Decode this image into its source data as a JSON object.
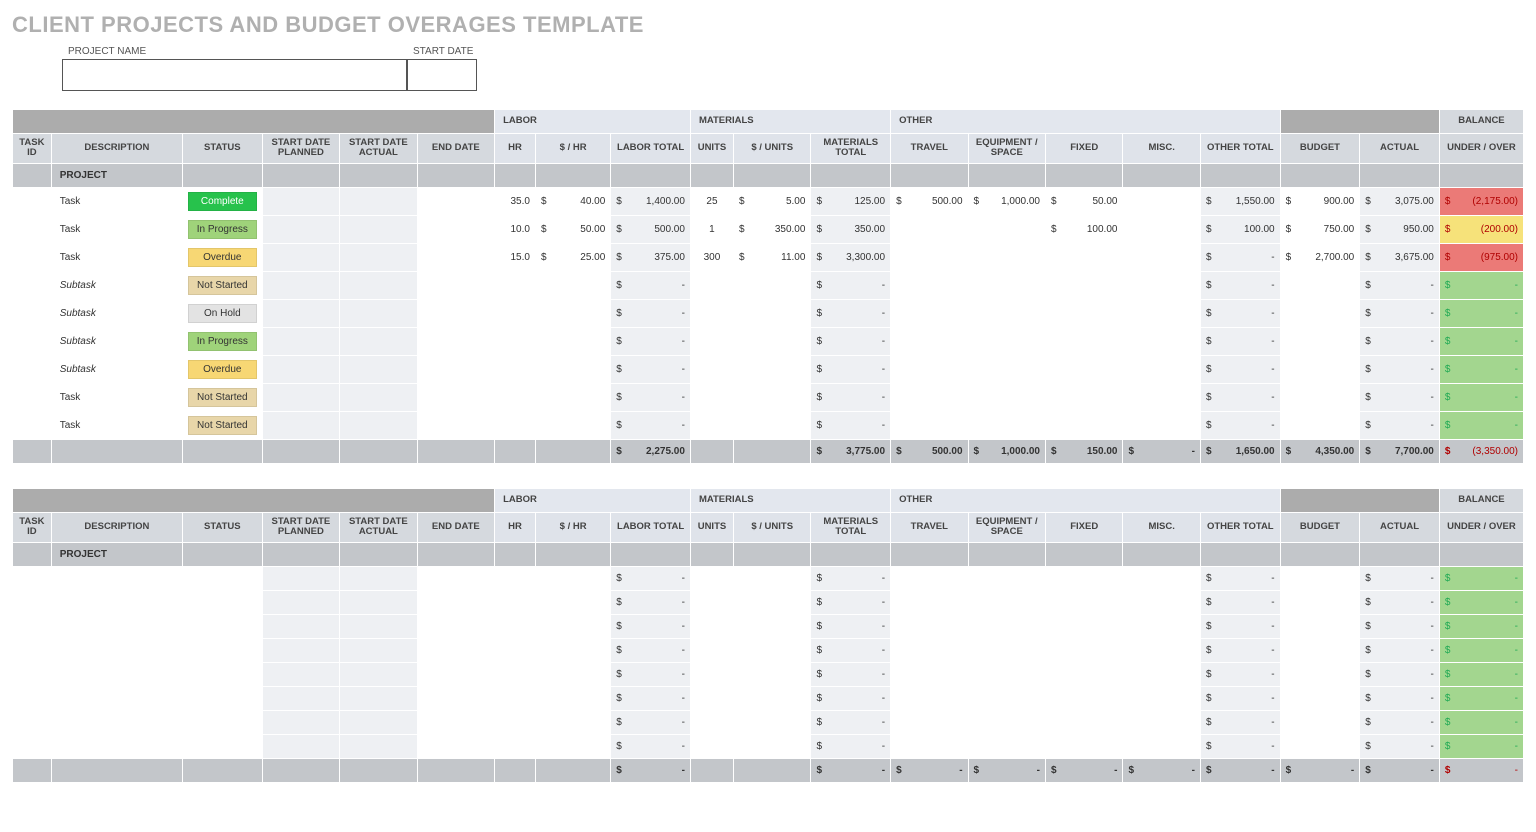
{
  "title": "CLIENT PROJECTS AND BUDGET OVERAGES TEMPLATE",
  "header": {
    "project_name_label": "PROJECT NAME",
    "start_date_label": "START DATE"
  },
  "groups": {
    "labor": "LABOR",
    "materials": "MATERIALS",
    "other": "OTHER",
    "balance": "BALANCE"
  },
  "columns": {
    "task_id": "TASK ID",
    "description": "DESCRIPTION",
    "status": "STATUS",
    "start_planned": "START DATE PLANNED",
    "start_actual": "START DATE ACTUAL",
    "end_date": "END DATE",
    "hr": "HR",
    "rate": "$ / HR",
    "labor_total": "LABOR TOTAL",
    "units": "UNITS",
    "unit_rate": "$ / UNITS",
    "materials_total": "MATERIALS TOTAL",
    "travel": "TRAVEL",
    "equipment": "EQUIPMENT / SPACE",
    "fixed": "FIXED",
    "misc": "MISC.",
    "other_total": "OTHER TOTAL",
    "budget": "BUDGET",
    "actual": "ACTUAL",
    "under_over": "UNDER / OVER"
  },
  "section1": {
    "project_label": "PROJECT",
    "rows": [
      {
        "desc": "Task",
        "sub": false,
        "status": "Complete",
        "status_cls": "st-complete",
        "hr": "35.0",
        "rate": "40.00",
        "labor_total": "1,400.00",
        "units": "25",
        "unit_rate": "5.00",
        "mat_total": "125.00",
        "travel": "500.00",
        "equipment": "1,000.00",
        "fixed": "50.00",
        "misc": "",
        "other_total": "1,550.00",
        "budget": "900.00",
        "actual": "3,075.00",
        "balance": "(2,175.00)",
        "bal_cls": "bal-neg"
      },
      {
        "desc": "Task",
        "sub": false,
        "status": "In Progress",
        "status_cls": "st-inprogress",
        "hr": "10.0",
        "rate": "50.00",
        "labor_total": "500.00",
        "units": "1",
        "unit_rate": "350.00",
        "mat_total": "350.00",
        "travel": "",
        "equipment": "",
        "fixed": "100.00",
        "misc": "",
        "other_total": "100.00",
        "budget": "750.00",
        "actual": "950.00",
        "balance": "(200.00)",
        "bal_cls": "bal-warn"
      },
      {
        "desc": "Task",
        "sub": false,
        "status": "Overdue",
        "status_cls": "st-overdue",
        "hr": "15.0",
        "rate": "25.00",
        "labor_total": "375.00",
        "units": "300",
        "unit_rate": "11.00",
        "mat_total": "3,300.00",
        "travel": "",
        "equipment": "",
        "fixed": "",
        "misc": "",
        "other_total": "-",
        "budget": "2,700.00",
        "actual": "3,675.00",
        "balance": "(975.00)",
        "bal_cls": "bal-neg"
      },
      {
        "desc": "Subtask",
        "sub": true,
        "status": "Not Started",
        "status_cls": "st-notstarted",
        "hr": "",
        "rate": "",
        "labor_total": "-",
        "units": "",
        "unit_rate": "",
        "mat_total": "-",
        "travel": "",
        "equipment": "",
        "fixed": "",
        "misc": "",
        "other_total": "-",
        "budget": "",
        "actual": "-",
        "balance": "-",
        "bal_cls": "bal-ok"
      },
      {
        "desc": "Subtask",
        "sub": true,
        "status": "On Hold",
        "status_cls": "st-onhold",
        "hr": "",
        "rate": "",
        "labor_total": "-",
        "units": "",
        "unit_rate": "",
        "mat_total": "-",
        "travel": "",
        "equipment": "",
        "fixed": "",
        "misc": "",
        "other_total": "-",
        "budget": "",
        "actual": "-",
        "balance": "-",
        "bal_cls": "bal-ok"
      },
      {
        "desc": "Subtask",
        "sub": true,
        "status": "In Progress",
        "status_cls": "st-inprogress",
        "hr": "",
        "rate": "",
        "labor_total": "-",
        "units": "",
        "unit_rate": "",
        "mat_total": "-",
        "travel": "",
        "equipment": "",
        "fixed": "",
        "misc": "",
        "other_total": "-",
        "budget": "",
        "actual": "-",
        "balance": "-",
        "bal_cls": "bal-ok"
      },
      {
        "desc": "Subtask",
        "sub": true,
        "status": "Overdue",
        "status_cls": "st-overdue",
        "hr": "",
        "rate": "",
        "labor_total": "-",
        "units": "",
        "unit_rate": "",
        "mat_total": "-",
        "travel": "",
        "equipment": "",
        "fixed": "",
        "misc": "",
        "other_total": "-",
        "budget": "",
        "actual": "-",
        "balance": "-",
        "bal_cls": "bal-ok"
      },
      {
        "desc": "Task",
        "sub": false,
        "status": "Not Started",
        "status_cls": "st-notstarted",
        "hr": "",
        "rate": "",
        "labor_total": "-",
        "units": "",
        "unit_rate": "",
        "mat_total": "-",
        "travel": "",
        "equipment": "",
        "fixed": "",
        "misc": "",
        "other_total": "-",
        "budget": "",
        "actual": "-",
        "balance": "-",
        "bal_cls": "bal-ok"
      },
      {
        "desc": "Task",
        "sub": false,
        "status": "Not Started",
        "status_cls": "st-notstarted",
        "hr": "",
        "rate": "",
        "labor_total": "-",
        "units": "",
        "unit_rate": "",
        "mat_total": "-",
        "travel": "",
        "equipment": "",
        "fixed": "",
        "misc": "",
        "other_total": "-",
        "budget": "",
        "actual": "-",
        "balance": "-",
        "bal_cls": "bal-ok"
      }
    ],
    "totals": {
      "labor_total": "2,275.00",
      "mat_total": "3,775.00",
      "travel": "500.00",
      "equipment": "1,000.00",
      "fixed": "150.00",
      "misc": "-",
      "other_total": "1,650.00",
      "budget": "4,350.00",
      "actual": "7,700.00",
      "balance": "(3,350.00)"
    }
  },
  "section2": {
    "project_label": "PROJECT",
    "row_count": 8,
    "totals_balance": "-"
  }
}
